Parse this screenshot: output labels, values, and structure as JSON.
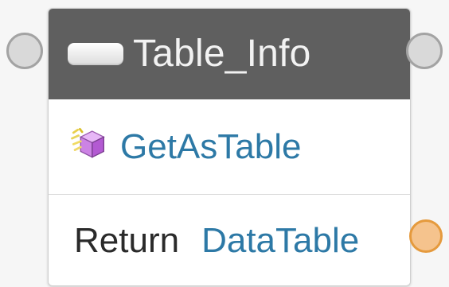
{
  "node": {
    "title": "Table_Info",
    "method": {
      "label": "GetAsTable",
      "icon": "method-cube-icon"
    },
    "returns": {
      "label": "Return",
      "type": "DataTable"
    },
    "ports": {
      "input": "input-port-icon",
      "header_output": "output-port-icon",
      "value_output": "return-port-icon"
    }
  },
  "colors": {
    "header": "#5f5f5f",
    "method_text": "#2d79a6",
    "return_port": "#e59a3d"
  }
}
